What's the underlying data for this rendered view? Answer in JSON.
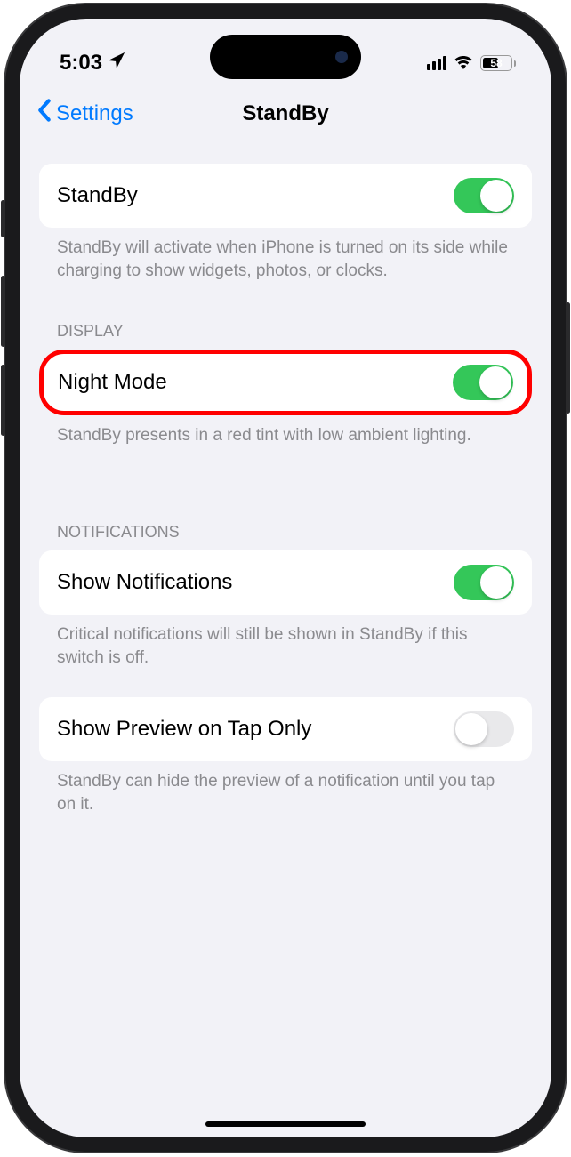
{
  "statusBar": {
    "time": "5:03",
    "batteryPercent": "58"
  },
  "nav": {
    "backLabel": "Settings",
    "title": "StandBy"
  },
  "sections": {
    "standby": {
      "label": "StandBy",
      "footer": "StandBy will activate when iPhone is turned on its side while charging to show widgets, photos, or clocks."
    },
    "display": {
      "header": "DISPLAY",
      "nightMode": {
        "label": "Night Mode",
        "footer": "StandBy presents in a red tint with low ambient lighting."
      }
    },
    "notifications": {
      "header": "NOTIFICATIONS",
      "show": {
        "label": "Show Notifications",
        "footer": "Critical notifications will still be shown in StandBy if this switch is off."
      },
      "preview": {
        "label": "Show Preview on Tap Only",
        "footer": "StandBy can hide the preview of a notification until you tap on it."
      }
    }
  },
  "toggles": {
    "standby": true,
    "nightMode": true,
    "showNotifications": true,
    "showPreview": false
  }
}
